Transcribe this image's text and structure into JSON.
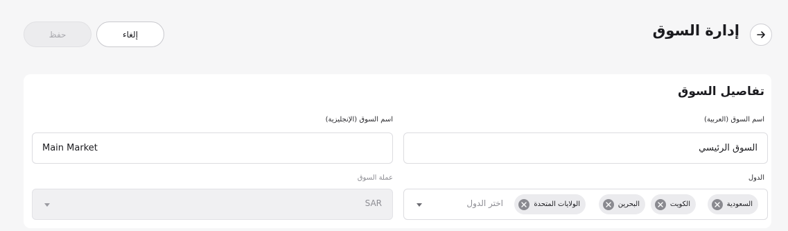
{
  "header": {
    "title": "إدارة السوق",
    "back_icon": "arrow-right-icon",
    "cancel_label": "إلغاء",
    "save_label": "حفظ"
  },
  "details": {
    "section_title": "تفاصيل السوق",
    "name_ar": {
      "label": "اسم السوق (العربية)",
      "value": "السوق الرئيسي"
    },
    "name_en": {
      "label": "اسم السوق (الإنجليزية)",
      "value": "Main Market"
    },
    "countries": {
      "label": "الدول",
      "placeholder": "اختر الدول",
      "chips": [
        "السعودية",
        "الكويت",
        "البحرين",
        "الولايات المتحدة"
      ]
    },
    "currency": {
      "label": "عملة السوق",
      "value": "SAR"
    }
  }
}
